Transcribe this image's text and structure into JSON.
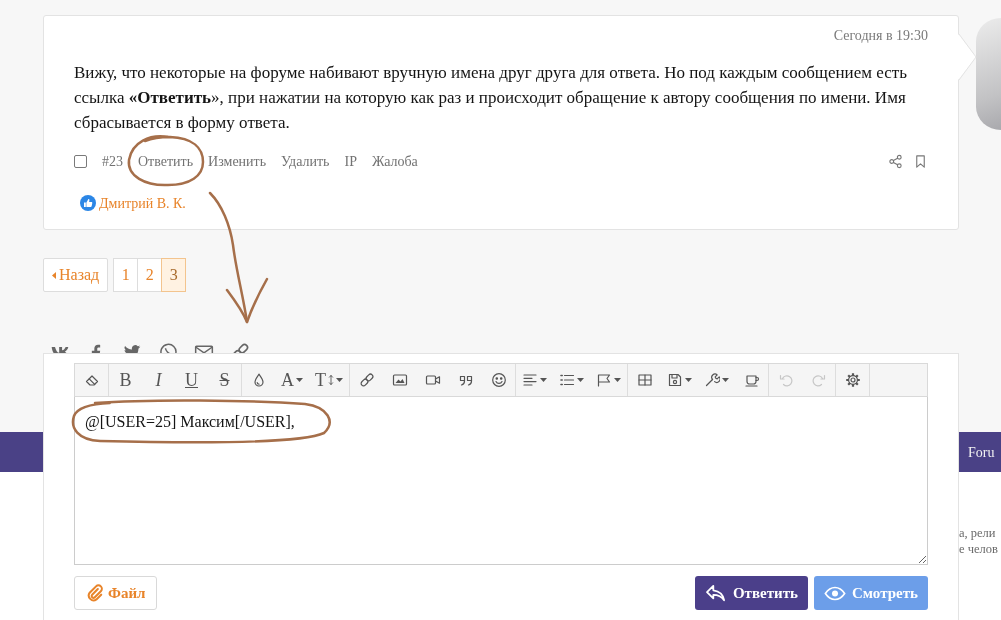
{
  "post": {
    "time": "Сегодня в 19:30",
    "text": "Вижу, что некоторые на форуме набивают вручную имена друг друга для ответа. Но под каждым сообщением есть ссылка **«Ответить**», при нажатии на которую как раз и происходит обращение к автору сообщения по имени. Имя сбрасывается в форму ответа.",
    "checked": false,
    "number": "#23",
    "actions": [
      "Ответить",
      "Изменить",
      "Удалить",
      "IP",
      "Жалоба"
    ],
    "likes": [
      {
        "name": "Дмитрий В. К."
      }
    ]
  },
  "pagination": {
    "prev": "Назад",
    "pages": [
      {
        "label": "1",
        "selected": false
      },
      {
        "label": "2",
        "selected": false
      },
      {
        "label": "3",
        "selected": true
      }
    ]
  },
  "nav_bar": {
    "label": "Foru"
  },
  "side_text": [
    "а, рели",
    "е челов"
  ],
  "editor": {
    "toolbar": [
      {
        "buttons": [
          {
            "kind": "eraser",
            "dropdown": false,
            "disabled": false
          }
        ]
      },
      {
        "buttons": [
          {
            "kind": "bold",
            "label": "B",
            "dropdown": false,
            "disabled": false
          },
          {
            "kind": "italic",
            "label": "I",
            "dropdown": false,
            "disabled": false
          },
          {
            "kind": "underline",
            "label": "U",
            "dropdown": false,
            "disabled": false
          },
          {
            "kind": "strike",
            "label": "S",
            "dropdown": false,
            "disabled": false
          }
        ]
      },
      {
        "buttons": [
          {
            "kind": "color",
            "dropdown": false,
            "disabled": false
          },
          {
            "kind": "font",
            "label": "A",
            "dropdown": true,
            "disabled": false
          },
          {
            "kind": "size",
            "label": "T",
            "dropdown": true,
            "disabled": false
          }
        ]
      },
      {
        "buttons": [
          {
            "kind": "link",
            "dropdown": false,
            "disabled": false
          },
          {
            "kind": "image",
            "dropdown": false,
            "disabled": false
          },
          {
            "kind": "video",
            "dropdown": false,
            "disabled": false
          },
          {
            "kind": "quote",
            "dropdown": false,
            "disabled": false
          },
          {
            "kind": "smilies",
            "dropdown": false,
            "disabled": false
          }
        ]
      },
      {
        "buttons": [
          {
            "kind": "align",
            "dropdown": true,
            "disabled": false
          },
          {
            "kind": "list",
            "dropdown": true,
            "disabled": false
          },
          {
            "kind": "flag",
            "dropdown": true,
            "disabled": false
          }
        ]
      },
      {
        "buttons": [
          {
            "kind": "table",
            "dropdown": false,
            "disabled": false
          },
          {
            "kind": "save",
            "dropdown": true,
            "disabled": false
          },
          {
            "kind": "tools",
            "dropdown": true,
            "disabled": false
          },
          {
            "kind": "cup",
            "dropdown": false,
            "disabled": false
          }
        ]
      },
      {
        "buttons": [
          {
            "kind": "undo",
            "dropdown": false,
            "disabled": true
          },
          {
            "kind": "redo",
            "dropdown": false,
            "disabled": true
          }
        ]
      },
      {
        "buttons": [
          {
            "kind": "settings",
            "dropdown": false,
            "disabled": false
          }
        ]
      }
    ],
    "text": "@[USER=25] Максим[/USER],"
  },
  "buttons": [
    {
      "kind": "attach",
      "label": "Файл"
    },
    {
      "kind": "reply",
      "label": "Ответить"
    },
    {
      "kind": "preview",
      "label": "Смотреть"
    }
  ]
}
